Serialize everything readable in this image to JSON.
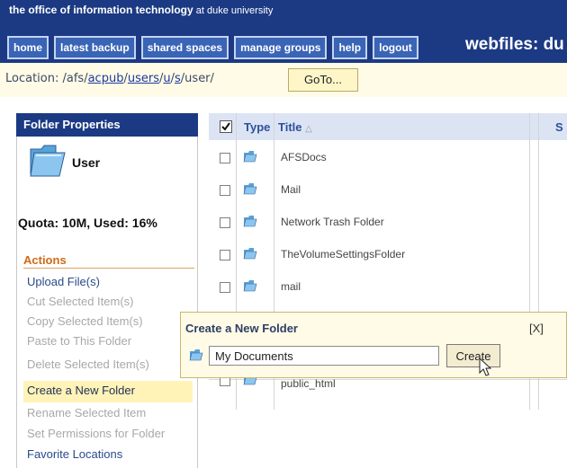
{
  "header": {
    "tagline_bold": "the office of information technology",
    "tagline_rest": " at duke university",
    "app_title": "webfiles: du",
    "nav": [
      "home",
      "latest backup",
      "shared spaces",
      "manage groups",
      "help",
      "logout"
    ]
  },
  "location": {
    "label": "Location:",
    "path_prefix": " /afs/",
    "seg1": "acpub",
    "sep1": "/",
    "seg2": "users",
    "sep2": "/",
    "seg3": "u",
    "sep3": "/",
    "seg4": "s",
    "path_suffix": "/user/",
    "goto_label": "GoTo..."
  },
  "folder_properties": {
    "header": "Folder Properties",
    "folder_name": "User",
    "quota": "Quota: 10M, Used: 16%"
  },
  "actions": {
    "header": "Actions",
    "items": [
      {
        "label": "Upload File(s)",
        "state": "active"
      },
      {
        "label": "Cut Selected Item(s)",
        "state": "disabled"
      },
      {
        "label": "Copy Selected Item(s)",
        "state": "disabled"
      },
      {
        "label": "Paste to This Folder",
        "state": "disabled"
      },
      {
        "label": "Delete Selected Item(s)",
        "state": "disabled"
      },
      {
        "label": "Create a New Folder",
        "state": "active"
      },
      {
        "label": "Rename Selected Item",
        "state": "disabled"
      },
      {
        "label": "Set Permissions for Folder",
        "state": "disabled"
      },
      {
        "label": "Favorite Locations",
        "state": "active"
      }
    ]
  },
  "table": {
    "col_type": "Type",
    "col_title": "Title",
    "sort_arrow": "△",
    "col_s": "S",
    "rows": [
      "AFSDocs",
      "Mail",
      "Network Trash Folder",
      "TheVolumeSettingsFolder",
      "mail",
      "",
      "public_html"
    ]
  },
  "popup": {
    "title": "Create a New Folder",
    "close": "[X]",
    "input_value": "My Documents",
    "button": "Create"
  },
  "colors": {
    "header_bg": "#1c3a83",
    "nav_btn": "#3a64b5",
    "actions_orange": "#d06a16",
    "popup_bg": "#fffbe6"
  }
}
